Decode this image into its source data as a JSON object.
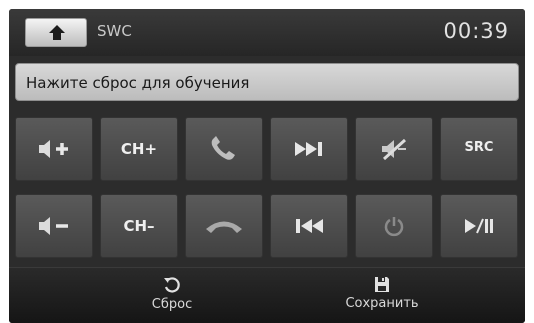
{
  "header": {
    "title": "SWC",
    "clock": "00:39"
  },
  "prompt": {
    "text": "Нажите сброс для обучения"
  },
  "keys": {
    "row1": [
      {
        "icon": "volume-up-icon"
      },
      {
        "label": "CH+"
      },
      {
        "icon": "phone-answer-icon"
      },
      {
        "icon": "next-track-icon"
      },
      {
        "icon": "mute-icon"
      },
      {
        "label": "SRC"
      }
    ],
    "row2": [
      {
        "icon": "volume-down-icon"
      },
      {
        "label": "CH–"
      },
      {
        "icon": "phone-hangup-icon"
      },
      {
        "icon": "previous-track-icon"
      },
      {
        "icon": "power-icon"
      },
      {
        "icon": "play-pause-icon"
      }
    ]
  },
  "footer": {
    "reset_label": "Сброс",
    "save_label": "Сохранить"
  }
}
